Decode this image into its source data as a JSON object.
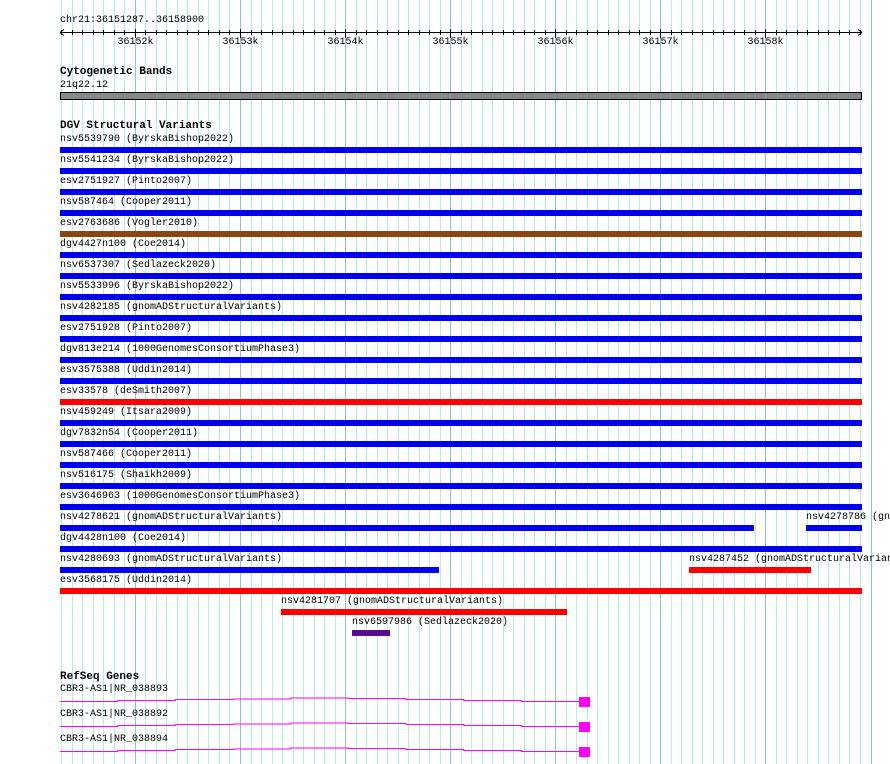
{
  "view": {
    "chrom": "chr21",
    "start": 36151287,
    "end": 36158900,
    "location_label": "chr21:36151287..36158900"
  },
  "ruler": {
    "ticks": [
      "36152k",
      "36153k",
      "36154k",
      "36155k",
      "36156k",
      "36157k",
      "36158k"
    ]
  },
  "colors": {
    "blue": "#0000ee",
    "red": "#ff0000",
    "brown": "#8b4513",
    "purple": "#5a0a8a",
    "magenta": "#ff00ff",
    "band": "#888888",
    "grid_minor": "#b4eaf2",
    "grid_major": "#86c3e6"
  },
  "cytobands": {
    "title": "Cytogenetic Bands",
    "band_label": "21q22.12"
  },
  "dgv": {
    "title": "DGV Structural Variants",
    "features": [
      {
        "row": 0,
        "label": "nsv5539790 (ByrskaBishop2022)",
        "color": "blue",
        "start": 36151287,
        "end": 36158930
      },
      {
        "row": 1,
        "label": "nsv5541234 (ByrskaBishop2022)",
        "color": "blue",
        "start": 36151287,
        "end": 36158930
      },
      {
        "row": 2,
        "label": "esv2751927 (Pinto2007)",
        "color": "blue",
        "start": 36151287,
        "end": 36158930
      },
      {
        "row": 3,
        "label": "nsv587464 (Cooper2011)",
        "color": "blue",
        "start": 36151287,
        "end": 36158930
      },
      {
        "row": 4,
        "label": "esv2763686 (Vogler2010)",
        "color": "brown",
        "start": 36151287,
        "end": 36158930
      },
      {
        "row": 5,
        "label": "dgv4427n100 (Coe2014)",
        "color": "blue",
        "start": 36151287,
        "end": 36158930
      },
      {
        "row": 6,
        "label": "nsv6537307 (Sedlazeck2020)",
        "color": "blue",
        "start": 36151287,
        "end": 36158930
      },
      {
        "row": 7,
        "label": "nsv5533996 (ByrskaBishop2022)",
        "color": "blue",
        "start": 36151287,
        "end": 36158930
      },
      {
        "row": 8,
        "label": "nsv4282185 (gnomADStructuralVariants)",
        "color": "blue",
        "start": 36151287,
        "end": 36158930
      },
      {
        "row": 9,
        "label": "esv2751928 (Pinto2007)",
        "color": "blue",
        "start": 36151287,
        "end": 36158930
      },
      {
        "row": 10,
        "label": "dgv813e214 (1000GenomesConsortiumPhase3)",
        "color": "blue",
        "start": 36151287,
        "end": 36158930
      },
      {
        "row": 11,
        "label": "esv3575388 (Uddin2014)",
        "color": "blue",
        "start": 36151287,
        "end": 36158930
      },
      {
        "row": 12,
        "label": "esv33578 (deSmith2007)",
        "color": "red",
        "start": 36151287,
        "end": 36158930
      },
      {
        "row": 13,
        "label": "nsv459249 (Itsara2009)",
        "color": "blue",
        "start": 36151287,
        "end": 36158930
      },
      {
        "row": 14,
        "label": "dgv7832n54 (Cooper2011)",
        "color": "blue",
        "start": 36151287,
        "end": 36158930
      },
      {
        "row": 15,
        "label": "nsv587466 (Cooper2011)",
        "color": "blue",
        "start": 36151287,
        "end": 36158930
      },
      {
        "row": 16,
        "label": "nsv516175 (Shaikh2009)",
        "color": "blue",
        "start": 36151287,
        "end": 36158930
      },
      {
        "row": 17,
        "label": "esv3646963 (1000GenomesConsortiumPhase3)",
        "color": "blue",
        "start": 36151287,
        "end": 36158930
      },
      {
        "row": 18,
        "label": "nsv4278621 (gnomADStructuralVariants)",
        "color": "blue",
        "start": 36151287,
        "end": 36157893
      },
      {
        "row": 18,
        "label": "nsv4278786 (gn",
        "color": "blue",
        "start": 36158387,
        "end": 36158930
      },
      {
        "row": 19,
        "label": "dgv4428n100 (Coe2014)",
        "color": "blue",
        "start": 36151287,
        "end": 36158930
      },
      {
        "row": 20,
        "label": "nsv4280693 (gnomADStructuralVariants)",
        "color": "blue",
        "start": 36151287,
        "end": 36154894
      },
      {
        "row": 20,
        "label": "nsv4287452 (gnomADStructuralVarian",
        "color": "red",
        "start": 36157277,
        "end": 36158435
      },
      {
        "row": 21,
        "label": "esv3568175 (Uddin2014)",
        "color": "red",
        "start": 36151287,
        "end": 36158930
      },
      {
        "row": 22,
        "label": "nsv4281707 (gnomADStructuralVariants)",
        "color": "red",
        "start": 36153394,
        "end": 36156109
      },
      {
        "row": 23,
        "label": "nsv6597986 (Sedlazeck2020)",
        "color": "purple",
        "start": 36154068,
        "end": 36154429
      }
    ]
  },
  "refseq": {
    "title": "RefSeq Genes",
    "genes": [
      {
        "label": "CBR3-AS1|NR_038893",
        "start": 36151270,
        "end": 36156216
      },
      {
        "label": "CBR3-AS1|NR_038892",
        "start": 36151270,
        "end": 36156216
      },
      {
        "label": "CBR3-AS1|NR_038894",
        "start": 36151270,
        "end": 36156216
      }
    ]
  }
}
